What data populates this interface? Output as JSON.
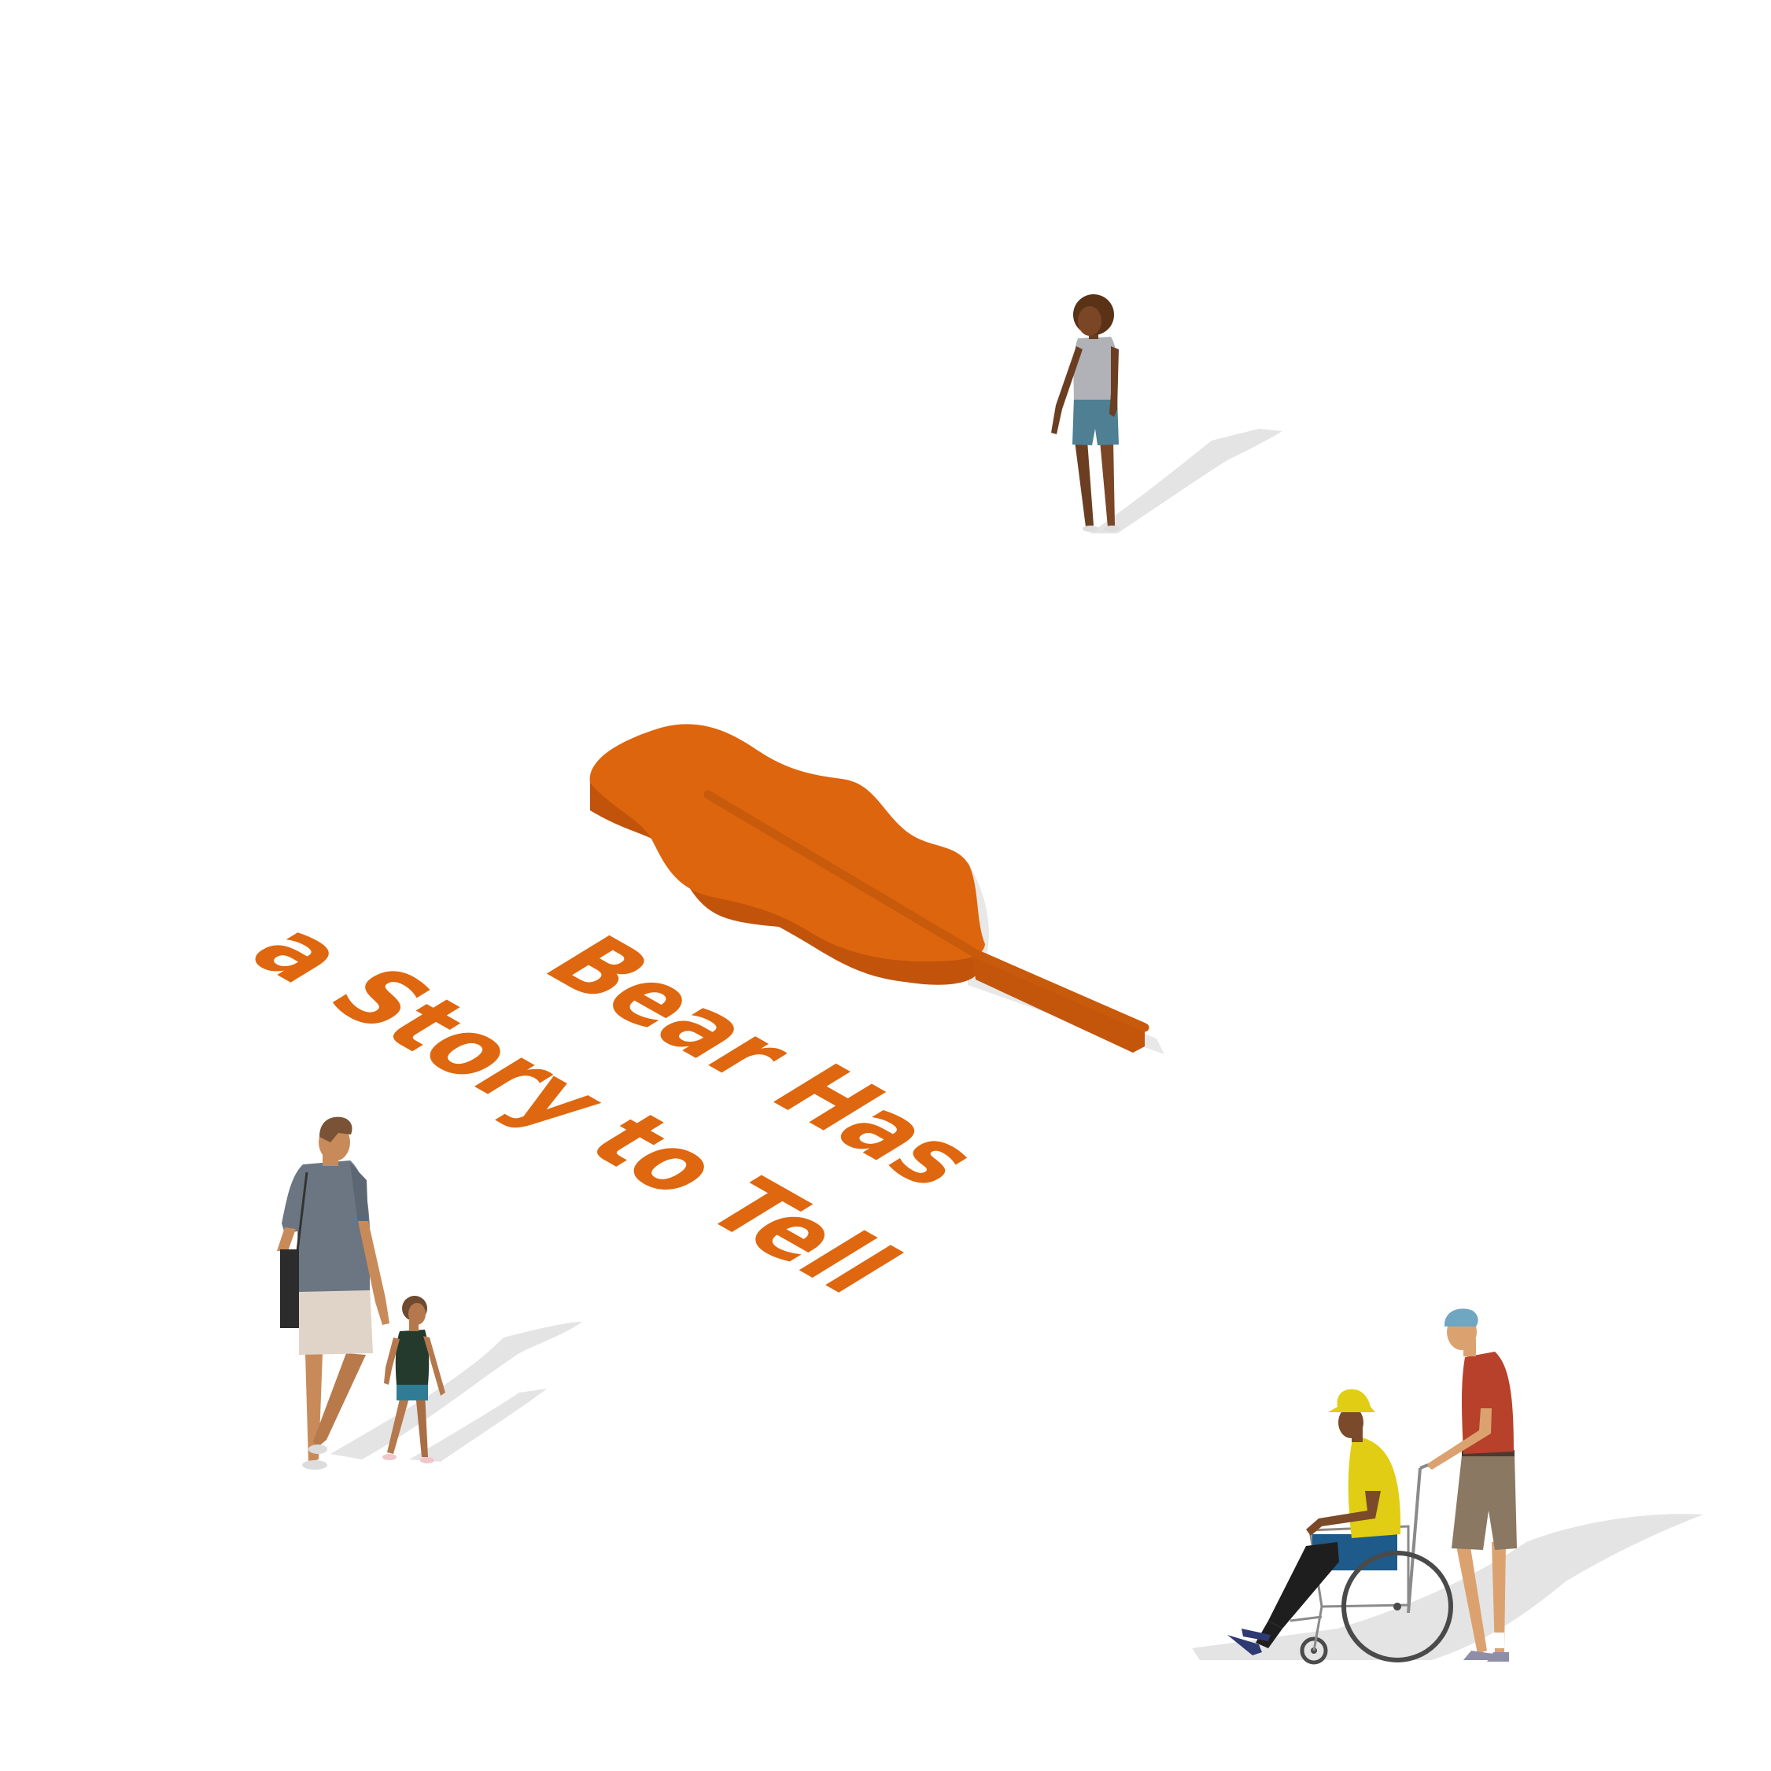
{
  "title": {
    "line1": "Bear Has",
    "line2": "a Story to Tell"
  },
  "colors": {
    "background": "#ffffff",
    "leaf_top": "#dd650d",
    "leaf_side": "#c2530b",
    "leaf_vein": "#c85a0c",
    "text": "#de670f",
    "shadow": "#e6e6e6"
  },
  "figures": [
    "woman-walking",
    "man-with-child",
    "person-pushing-wheelchair"
  ]
}
